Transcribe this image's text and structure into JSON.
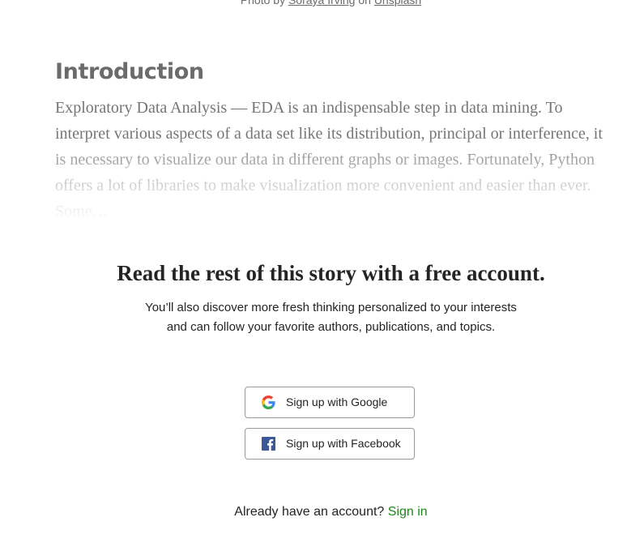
{
  "photo_caption": {
    "prefix": "Photo by",
    "author": "Soraya Irving",
    "connector": "on",
    "source": "Unsplash"
  },
  "article": {
    "section_heading": "Introduction",
    "excerpt": "Exploratory Data Analysis — EDA is an indispensable step in data mining. To interpret various aspects of a data set like its distribution, principal or interference, it is necessary to visualize our data in different graphs or images. Fortunately, Python offers a lot of libraries to make visualization more convenient and easier than ever. Some…"
  },
  "paywall": {
    "title": "Read the rest of this story with a free account.",
    "subtitle_line1": "You’ll also discover more fresh thinking personalized to your interests",
    "subtitle_line2": "and can follow your favorite authors, publications, and topics.",
    "google_button": "Sign up with Google",
    "facebook_button": "Sign up with Facebook",
    "signin_prompt": "Already have an account?",
    "signin_link": "Sign in"
  },
  "icons": {
    "google": "google-logo-icon",
    "facebook": "facebook-logo-icon"
  },
  "colors": {
    "signin_link": "#1a8917",
    "facebook_blue": "#3b5998",
    "text_dark": "#242424",
    "text_muted": "#757575"
  }
}
